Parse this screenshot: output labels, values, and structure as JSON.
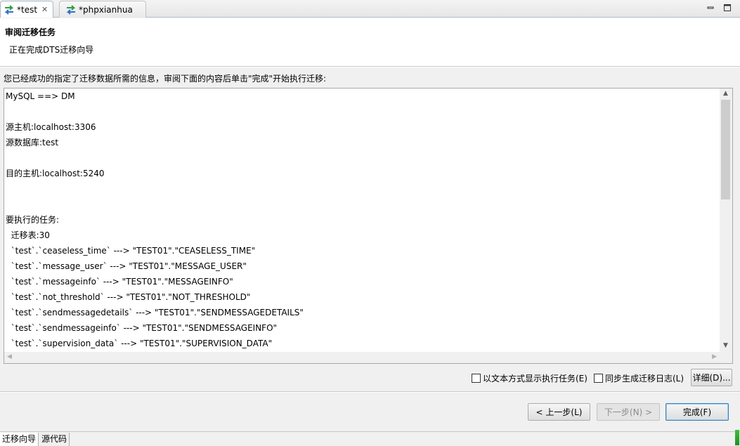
{
  "tabs": [
    {
      "label": "*test",
      "active": true,
      "icon": "migrate-arrows-icon"
    },
    {
      "label": "*phpxianhua",
      "active": false,
      "icon": "migrate-arrows-icon"
    }
  ],
  "window_controls": {
    "minimize": "minimize-icon",
    "maximize": "maximize-icon"
  },
  "wizard": {
    "title": "审阅迁移任务",
    "description": "正在完成DTS迁移向导",
    "intro": "您已经成功的指定了迁移数据所需的信息，审阅下面的内容后单击\"完成\"开始执行迁移:"
  },
  "summary_lines": [
    "MySQL ==> DM",
    "",
    "源主机:localhost:3306",
    "源数据库:test",
    "",
    "目的主机:localhost:5240",
    "",
    "",
    "要执行的任务:",
    "  迁移表:30",
    "  `test`.`ceaseless_time` ---> \"TEST01\".\"CEASELESS_TIME\"",
    "  `test`.`message_user` ---> \"TEST01\".\"MESSAGE_USER\"",
    "  `test`.`messageinfo` ---> \"TEST01\".\"MESSAGEINFO\"",
    "  `test`.`not_threshold` ---> \"TEST01\".\"NOT_THRESHOLD\"",
    "  `test`.`sendmessagedetails` ---> \"TEST01\".\"SENDMESSAGEDETAILS\"",
    "  `test`.`sendmessageinfo` ---> \"TEST01\".\"SENDMESSAGEINFO\"",
    "  `test`.`supervision_data` ---> \"TEST01\".\"SUPERVISION_DATA\""
  ],
  "options": {
    "show_as_text": {
      "label": "以文本方式显示执行任务(E)",
      "checked": false
    },
    "sync_log": {
      "label": "同步生成迁移日志(L)",
      "checked": false
    },
    "details_button": "详细(D)..."
  },
  "buttons": {
    "back": "< 上一步(L)",
    "next": "下一步(N) >",
    "finish": "完成(F)"
  },
  "bottom_tabs": [
    {
      "label": "迁移向导",
      "active": true
    },
    {
      "label": "源代码",
      "active": false
    }
  ],
  "colors": {
    "accent": "#3c7fb1",
    "tab_icon_green": "#2e9e3e",
    "tab_icon_blue": "#2f6fd0"
  }
}
